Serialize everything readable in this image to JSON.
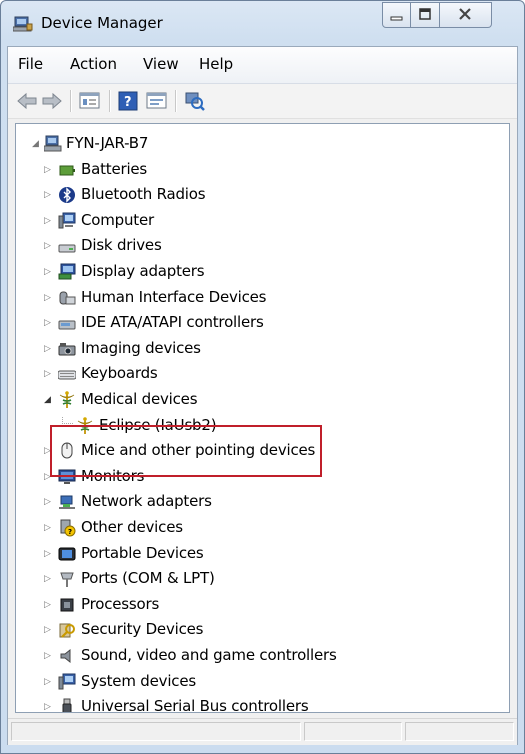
{
  "window": {
    "title": "Device Manager"
  },
  "menubar": {
    "items": [
      "File",
      "Action",
      "View",
      "Help"
    ]
  },
  "toolbar": {
    "buttons": [
      "back",
      "forward",
      "show-hide-console-tree",
      "help",
      "properties",
      "scan-for-hardware-changes"
    ]
  },
  "tree": {
    "root": "FYN-JAR-B7",
    "categories": [
      {
        "label": "Batteries",
        "icon": "battery-icon",
        "expanded": false
      },
      {
        "label": "Bluetooth Radios",
        "icon": "bluetooth-icon",
        "expanded": false
      },
      {
        "label": "Computer",
        "icon": "computer-icon",
        "expanded": false
      },
      {
        "label": "Disk drives",
        "icon": "disk-drive-icon",
        "expanded": false
      },
      {
        "label": "Display adapters",
        "icon": "display-adapter-icon",
        "expanded": false
      },
      {
        "label": "Human Interface Devices",
        "icon": "hid-icon",
        "expanded": false
      },
      {
        "label": "IDE ATA/ATAPI controllers",
        "icon": "ide-controller-icon",
        "expanded": false
      },
      {
        "label": "Imaging devices",
        "icon": "imaging-device-icon",
        "expanded": false
      },
      {
        "label": "Keyboards",
        "icon": "keyboard-icon",
        "expanded": false
      },
      {
        "label": "Medical devices",
        "icon": "medical-caduceus-icon",
        "expanded": true,
        "children": [
          {
            "label": "Eclipse (IaUsb2)",
            "icon": "medical-caduceus-icon"
          }
        ]
      },
      {
        "label": "Mice and other pointing devices",
        "icon": "mouse-icon",
        "expanded": false
      },
      {
        "label": "Monitors",
        "icon": "monitor-icon",
        "expanded": false
      },
      {
        "label": "Network adapters",
        "icon": "network-adapter-icon",
        "expanded": false
      },
      {
        "label": "Other devices",
        "icon": "other-device-icon",
        "expanded": false
      },
      {
        "label": "Portable Devices",
        "icon": "portable-device-icon",
        "expanded": false
      },
      {
        "label": "Ports (COM & LPT)",
        "icon": "port-icon",
        "expanded": false
      },
      {
        "label": "Processors",
        "icon": "processor-icon",
        "expanded": false
      },
      {
        "label": "Security Devices",
        "icon": "security-device-icon",
        "expanded": false
      },
      {
        "label": "Sound, video and game controllers",
        "icon": "sound-icon",
        "expanded": false
      },
      {
        "label": "System devices",
        "icon": "system-device-icon",
        "expanded": false
      },
      {
        "label": "Universal Serial Bus controllers",
        "icon": "usb-icon",
        "expanded": false
      }
    ]
  },
  "colors": {
    "highlight_border": "#c01f2a",
    "titlebar": "#cbdcef",
    "tree_background": "#ffffff"
  }
}
